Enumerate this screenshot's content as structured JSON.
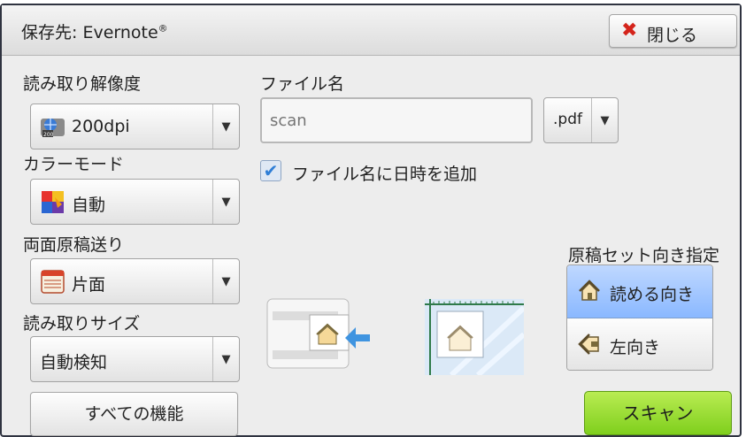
{
  "titlebar": {
    "title": "保存先: Evernote",
    "title_mark": "®",
    "close_label": "閉じる"
  },
  "resolution": {
    "label": "読み取り解像度",
    "value": "200dpi",
    "icon": "resolution-globe-icon"
  },
  "color_mode": {
    "label": "カラーモード",
    "value": "自動",
    "icon": "color-palette-icon"
  },
  "duplex": {
    "label": "両面原稿送り",
    "value": "片面",
    "icon": "single-sided-page-icon"
  },
  "scan_size": {
    "label": "読み取りサイズ",
    "value": "自動検知"
  },
  "filename": {
    "label": "ファイル名",
    "placeholder": "scan",
    "extension": ".pdf"
  },
  "add_datetime": {
    "label": "ファイル名に日時を追加",
    "checked": true
  },
  "orientation": {
    "label": "原稿セット向き指定",
    "options": [
      {
        "label": "読める向き",
        "selected": true,
        "icon": "house-upright-icon"
      },
      {
        "label": "左向き",
        "selected": false,
        "icon": "house-left-icon"
      }
    ]
  },
  "buttons": {
    "all_functions": "すべての機能",
    "scan": "スキャン"
  },
  "colors": {
    "scan_button": "#8fd62a",
    "selected_option": "#a8c9ff",
    "close_icon": "#d4241b"
  }
}
